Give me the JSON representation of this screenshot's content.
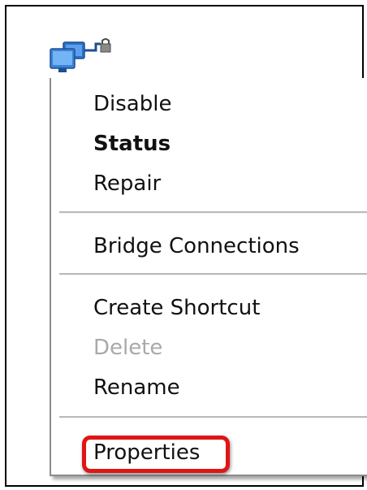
{
  "context_menu": {
    "items": [
      {
        "label": "Disable",
        "state": "normal"
      },
      {
        "label": "Status",
        "state": "default"
      },
      {
        "label": "Repair",
        "state": "normal"
      },
      {
        "label": "Bridge Connections",
        "state": "normal"
      },
      {
        "label": "Create Shortcut",
        "state": "normal"
      },
      {
        "label": "Delete",
        "state": "disabled"
      },
      {
        "label": "Rename",
        "state": "normal"
      },
      {
        "label": "Properties",
        "state": "highlighted"
      }
    ]
  },
  "icon": "network-connection-icon",
  "colors": {
    "highlight_ring": "#e01515",
    "disabled_text": "#a9a9a9",
    "icon_blue": "#3b82d8"
  }
}
